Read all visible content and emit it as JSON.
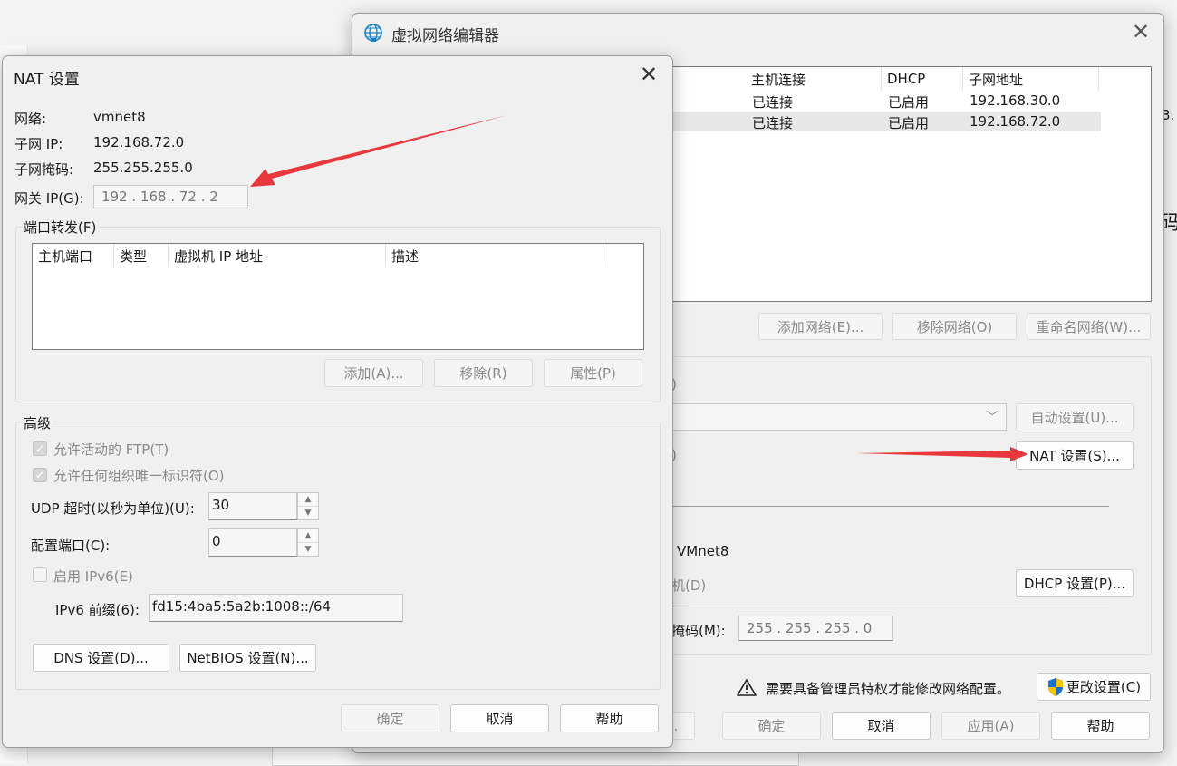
{
  "main_window": {
    "title": "虚拟网络编辑器",
    "table": {
      "headers": [
        "主机连接",
        "DHCP",
        "子网地址"
      ],
      "rows": [
        [
          "已连接",
          "已启用",
          "192.168.30.0"
        ],
        [
          "已连接",
          "已启用",
          "192.168.72.0"
        ]
      ]
    },
    "add_network_label": "添加网络(E)...",
    "remove_network_label": "移除网络(O)",
    "rename_network_label": "重命名网络(W)...",
    "partial_label_1": ")",
    "partial_label_2": ")",
    "auto_settings_label": "自动设置(U)...",
    "nat_settings_label": "NAT 设置(S)...",
    "vmnet_name": "VMnet8",
    "partial_dhcp_label": "机(D)",
    "dhcp_settings_label": "DHCP 设置(P)...",
    "partial_mask_label": "掩码(M):",
    "subnet_mask_value": "255 . 255 . 255 .  0",
    "admin_warning": "需要具备管理员特权才能修改网络配置。",
    "change_settings_label": "更改设置(C)",
    "partial_btn_label": "...",
    "ok_label": "确定",
    "cancel_label": "取消",
    "apply_label": "应用(A)",
    "help_label": "帮助"
  },
  "bg_partial": {
    "right_text_1": "3.",
    "right_text_2": "码"
  },
  "nat_dialog": {
    "title": "NAT 设置",
    "network_label": "网络:",
    "network_value": "vmnet8",
    "subnet_ip_label": "子网 IP:",
    "subnet_ip_value": "192.168.72.0",
    "subnet_mask_label": "子网掩码:",
    "subnet_mask_value": "255.255.255.0",
    "gateway_label": "网关 IP(G):",
    "gateway_value": "192 . 168 . 72  .  2",
    "port_forward": {
      "title": "端口转发(F)",
      "headers": [
        "主机端口",
        "类型",
        "虚拟机 IP 地址",
        "描述"
      ],
      "add_label": "添加(A)...",
      "remove_label": "移除(R)",
      "properties_label": "属性(P)"
    },
    "advanced": {
      "title": "高级",
      "allow_ftp_label": "允许活动的 FTP(T)",
      "allow_uid_label": "允许任何组织唯一标识符(O)",
      "udp_timeout_label": "UDP 超时(以秒为单位)(U):",
      "udp_timeout_value": "30",
      "config_port_label": "配置端口(C):",
      "config_port_value": "0",
      "enable_ipv6_label": "启用 IPv6(E)",
      "ipv6_prefix_label": "IPv6 前缀(6):",
      "ipv6_prefix_value": "fd15:4ba5:5a2b:1008::/64",
      "dns_label": "DNS 设置(D)...",
      "netbios_label": "NetBIOS 设置(N)..."
    },
    "ok_label": "确定",
    "cancel_label": "取消",
    "help_label": "帮助"
  },
  "colors": {
    "arrow": "#e8383d",
    "shield_blue": "#1f6fd1",
    "shield_yellow": "#f5c400"
  }
}
